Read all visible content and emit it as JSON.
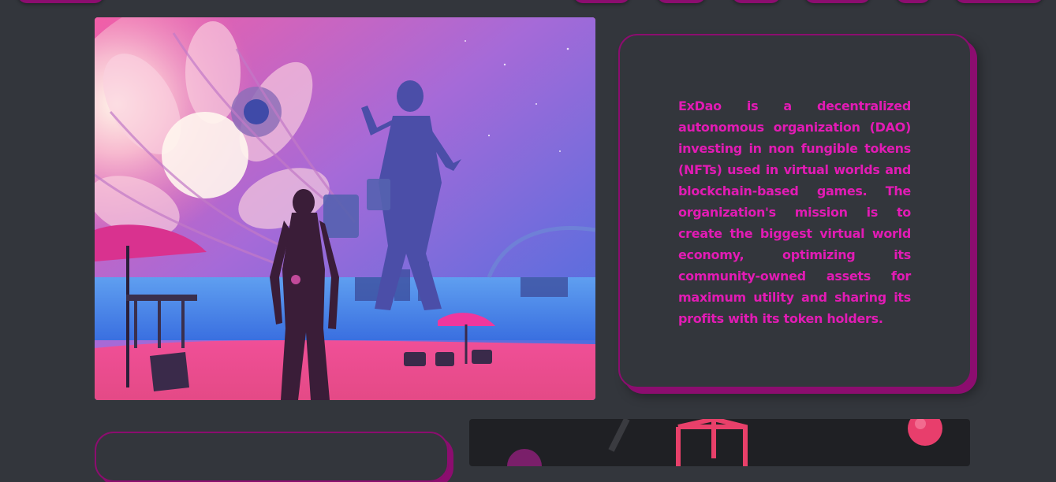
{
  "about": {
    "description": "ExDao is a decentralized autonomous organization (DAO) investing in non fungible tokens (NFTs) used in virtual worlds and blockchain-based games. The organization's mission is to create the biggest virtual world economy, optimizing its community-owned assets for maximum utility and sharing its profits with its token holders."
  },
  "colors": {
    "background": "#33363c",
    "accent": "#8c0d6f",
    "text_accent": "#e21bb4"
  }
}
